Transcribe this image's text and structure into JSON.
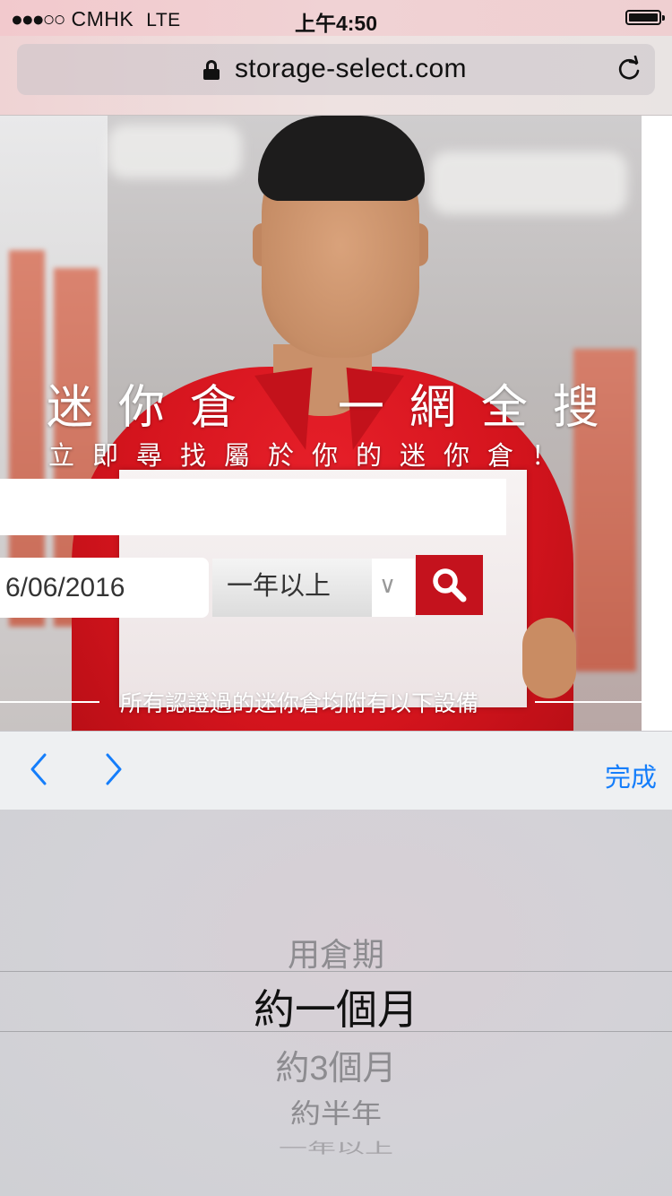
{
  "status_bar": {
    "signal_dots": "●●●○○",
    "carrier": "CMHK",
    "network": "LTE",
    "time": "上午4:50"
  },
  "browser": {
    "url": "storage-select.com"
  },
  "hero": {
    "headline": "迷你倉  一網全搜",
    "subheadline": "立即尋找屬於你的迷你倉！",
    "location_input_value": "",
    "date_value": "6/06/2016",
    "duration_value": "一年以上",
    "equipment_text": "所有認證過的迷你倉均附有以下設備"
  },
  "keyboard_accessory": {
    "done_label": "完成"
  },
  "picker": {
    "options": [
      "用倉期",
      "約一個月",
      "約3個月",
      "約半年",
      "一年以上"
    ],
    "selected_index": 1
  }
}
